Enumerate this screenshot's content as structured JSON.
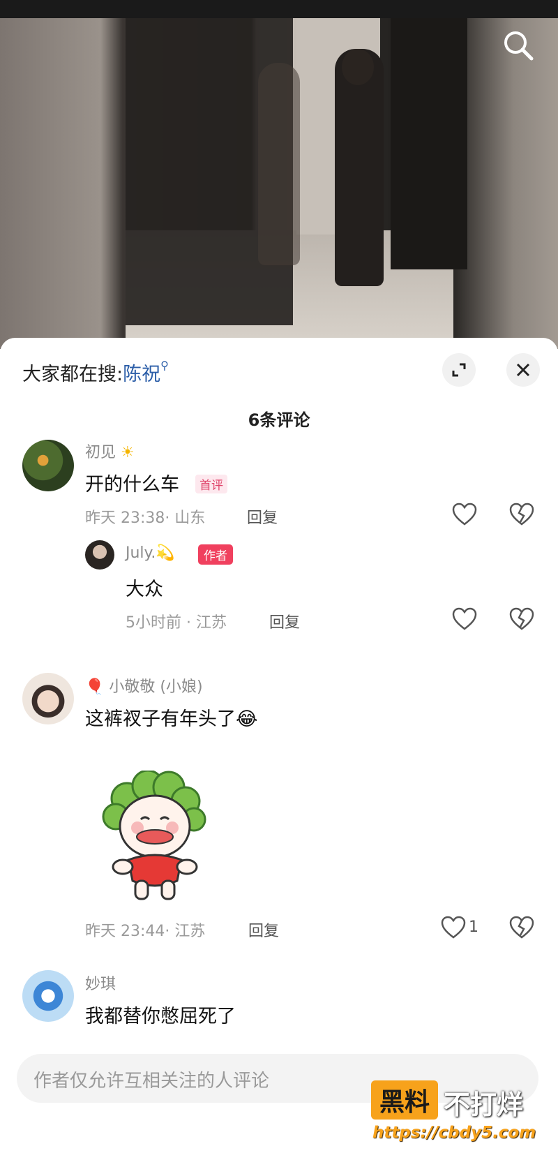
{
  "search_hint": {
    "prefix": "大家都在搜:",
    "keyword": "陈祝"
  },
  "comment_count_title": "6条评论",
  "comments": [
    {
      "user": "初见",
      "user_emoji": "☀",
      "text": "开的什么车",
      "tag": "首评",
      "time": "昨天 23:38",
      "location": "· 山东",
      "reply_label": "回复",
      "replies": [
        {
          "user": "July.",
          "user_emoji": "💫",
          "tag": "作者",
          "text": "大众",
          "time": "5小时前",
          "location": "· 江苏",
          "reply_label": "回复"
        }
      ]
    },
    {
      "user_prefix_emoji": "🎈",
      "user": "小敬敬 (小娘)",
      "text": "这裤衩子有年头了",
      "text_emoji": "😂",
      "time": "昨天 23:44",
      "location": "· 江苏",
      "reply_label": "回复",
      "likes": "1"
    },
    {
      "user": "妙琪",
      "text": "我都替你憋屈死了"
    }
  ],
  "input_placeholder": "作者仅允许互相关注的人评论",
  "watermark": {
    "box": "黑料",
    "rest": "不打烊",
    "url": "https://cbdy5.com"
  },
  "colors": {
    "keyword": "#2c5ea8",
    "author_tag": "#f0405e",
    "first_tag": "#e0446a",
    "watermark_orange": "#f7a21b"
  }
}
